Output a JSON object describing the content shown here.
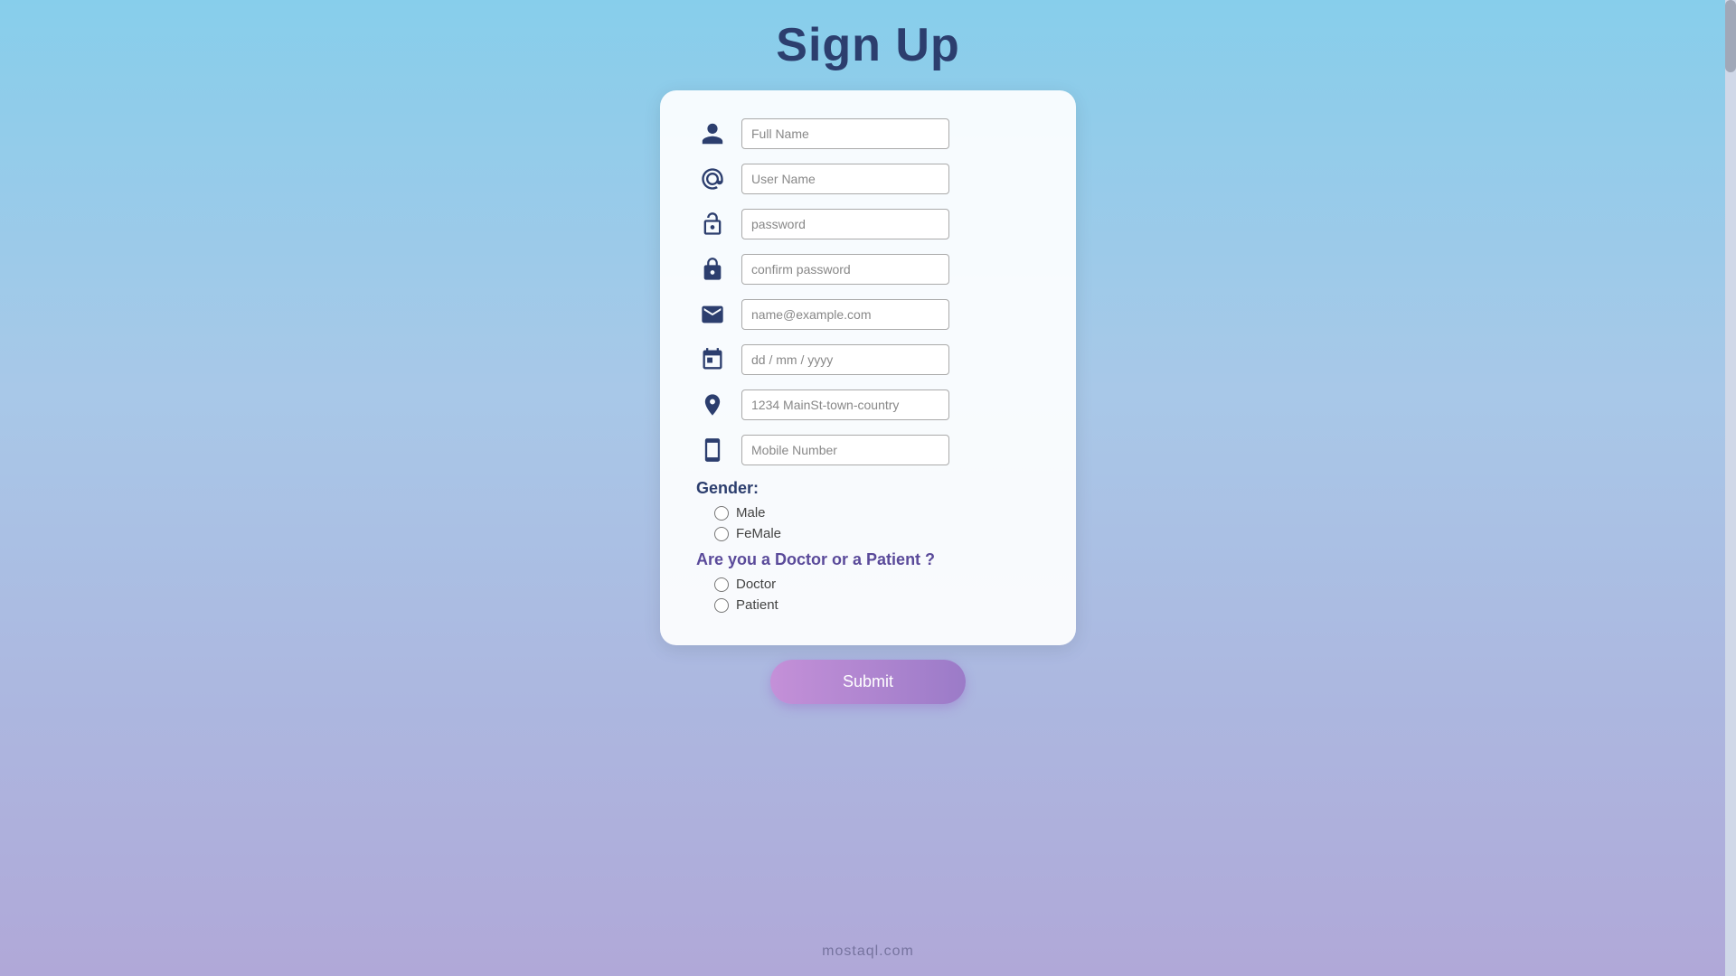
{
  "page": {
    "title": "Sign Up",
    "watermark": "mostaql.com"
  },
  "form": {
    "fields": {
      "fullname_placeholder": "Full Name",
      "username_placeholder": "User Name",
      "password_placeholder": "password",
      "confirm_password_placeholder": "confirm password",
      "email_placeholder": "name@example.com",
      "dob_placeholder": "dd / mm / yyyy",
      "address_placeholder": "1234 MainSt-town-country",
      "mobile_placeholder": "Mobile Number"
    },
    "gender": {
      "label": "Gender:",
      "options": [
        "Male",
        "FeMale"
      ]
    },
    "role": {
      "label": "Are you a Doctor or a Patient ?",
      "options": [
        "Doctor",
        "Patient"
      ]
    },
    "submit_label": "Submit"
  }
}
